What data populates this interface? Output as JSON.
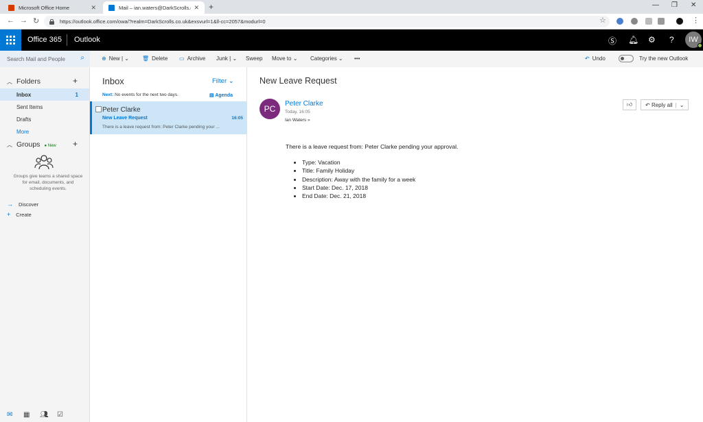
{
  "browser": {
    "tabs": [
      {
        "title": "Microsoft Office Home",
        "icon": "office-icon",
        "color": "#d83b01"
      },
      {
        "title": "Mail – ian.waters@DarkScrolls.co",
        "icon": "outlook-icon",
        "color": "#0078d4"
      }
    ],
    "url": "https://outlook.office.com/owa/?realm=DarkScrolls.co.uk&exsvurl=1&ll-cc=2057&modurl=0"
  },
  "header": {
    "brand": "Office 365",
    "app": "Outlook",
    "user_initials": "IW"
  },
  "search": {
    "placeholder": "Search Mail and People"
  },
  "toolbar": {
    "new": "New",
    "delete": "Delete",
    "archive": "Archive",
    "junk": "Junk",
    "sweep": "Sweep",
    "move_to": "Move to",
    "categories": "Categories",
    "more": "•••",
    "undo": "Undo",
    "try_new": "Try the new Outlook"
  },
  "sidebar": {
    "folders_label": "Folders",
    "items": [
      {
        "label": "Inbox",
        "count": "1"
      },
      {
        "label": "Sent Items"
      },
      {
        "label": "Drafts"
      },
      {
        "label": "More"
      }
    ],
    "groups_label": "Groups",
    "groups_new": "New",
    "groups_desc": "Groups give teams a shared space for email, documents, and scheduling events.",
    "discover": "Discover",
    "create": "Create"
  },
  "message_list": {
    "title": "Inbox",
    "filter": "Filter",
    "next_label": "Next:",
    "next_text": "No events for the next two days.",
    "agenda": "Agenda",
    "messages": [
      {
        "from": "Peter Clarke",
        "subject": "New Leave Request",
        "time": "16:05",
        "preview": "There is a leave request from: Peter Clarke pending your ..."
      }
    ]
  },
  "reading": {
    "subject": "New Leave Request",
    "sender_initials": "PC",
    "sender": "Peter Clarke",
    "date": "Today, 16:05",
    "to": "Ian Waters",
    "reply_all": "Reply all",
    "body_intro": "There is a leave request from: Peter Clarke pending your approval.",
    "details": [
      "Type: Vacation",
      "Title: Family Holiday",
      "Description: Away with the family for a week",
      "Start Date: Dec. 17, 2018",
      "End Date: Dec. 21, 2018"
    ]
  },
  "colors": {
    "accent": "#0078d4",
    "header_bg": "#000000",
    "selected_bg": "#cde6f7",
    "avatar_pc": "#7b2a7d"
  }
}
